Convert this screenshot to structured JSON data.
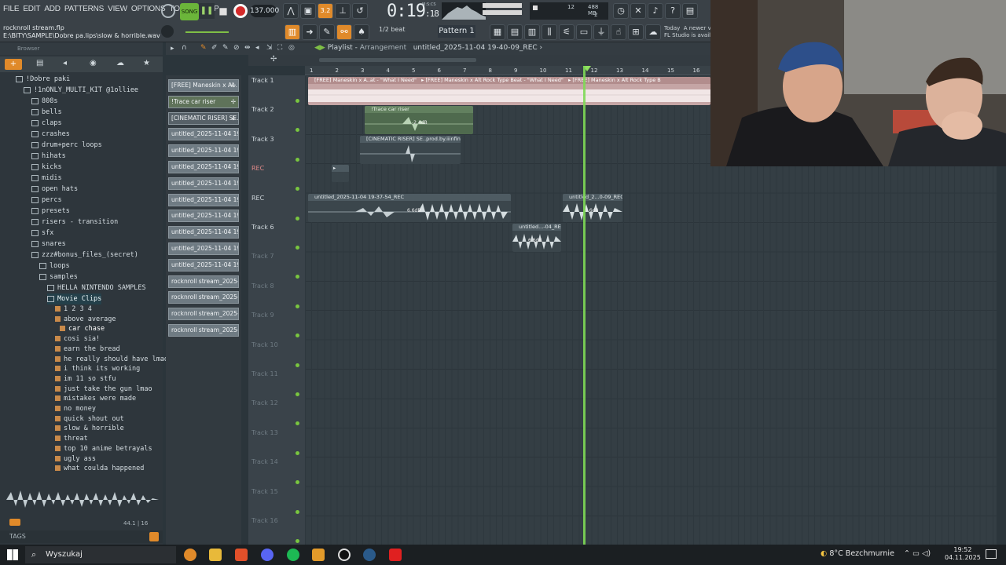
{
  "menu": [
    "FILE",
    "EDIT",
    "ADD",
    "PATTERNS",
    "VIEW",
    "OPTIONS",
    "TOOLS",
    "HELP"
  ],
  "transport": {
    "song": "SONG",
    "tempo": "137.000",
    "time_main": "0:19",
    "time_sub": ":18",
    "time_unit": "M:S:CS",
    "snap": "1/2 beat",
    "pattern": "Pattern 1"
  },
  "status": {
    "mem": "488 MB",
    "cpu_a": "12",
    "cpu_b": "2",
    "hint_date": "Today",
    "hint_text": "A newer ve",
    "hint_text2": "FL Studio is availal"
  },
  "project": {
    "file": "rocknroll stream.flp",
    "path": "E:\\BITY\\SAMPLE\\Dobre pa.lips\\slow & horrible.wav"
  },
  "browser": {
    "title": "Browser",
    "tree": [
      {
        "label": "!Dobre paki",
        "level": 1
      },
      {
        "label": "!1nONLY_MULTI_KIT @1olliee",
        "level": 2
      },
      {
        "label": "808s",
        "level": 3
      },
      {
        "label": "bells",
        "level": 3
      },
      {
        "label": "claps",
        "level": 3
      },
      {
        "label": "crashes",
        "level": 3
      },
      {
        "label": "drum+perc loops",
        "level": 3
      },
      {
        "label": "hihats",
        "level": 3
      },
      {
        "label": "kicks",
        "level": 3
      },
      {
        "label": "midis",
        "level": 3
      },
      {
        "label": "open hats",
        "level": 3
      },
      {
        "label": "percs",
        "level": 3
      },
      {
        "label": "presets",
        "level": 3
      },
      {
        "label": "risers - transition",
        "level": 3
      },
      {
        "label": "sfx",
        "level": 3
      },
      {
        "label": "snares",
        "level": 3
      },
      {
        "label": "zzz#bonus_files_(secret)",
        "level": 3
      },
      {
        "label": "loops",
        "level": 4
      },
      {
        "label": "samples",
        "level": 4
      },
      {
        "label": "HELLA NINTENDO SAMPLES",
        "level": 5
      },
      {
        "label": "Movie Clips",
        "level": 5
      }
    ],
    "files": [
      "1 2 3 4",
      "above average",
      "car chase",
      "cosi sia!",
      "earn the bread",
      "he really should have lmao",
      "i think its working",
      "im 11 so stfu",
      "just take the gun lmao",
      "mistakes were made",
      "no money",
      "quick shout out",
      "slow & horrible",
      "threat",
      "top 10 anime betrayals",
      "ugly ass",
      "what coulda happened"
    ],
    "preview_info": "44.1",
    "preview_bits": "16",
    "tags": "TAGS"
  },
  "patterns": [
    "[FREE] Maneskin x Al..",
    "!Trace car riser",
    "[CINEMATIC RISER] SE..",
    "untitled_2025-11-04 19-..",
    "untitled_2025-11-04 19-..",
    "untitled_2025-11-04 19-..",
    "untitled_2025-11-04 19-..",
    "untitled_2025-11-04 19-..",
    "untitled_2025-11-04 19-..",
    "untitled_2025-11-04 19-..",
    "untitled_2025-11-04 19-..",
    "untitled_2025-11-04 19-..",
    "rocknroll stream_2025-1..",
    "rocknroll stream_2025-1..",
    "rocknroll stream_2025-1..",
    "rocknroll stream_2025-1.."
  ],
  "playlist": {
    "title": "Playlist",
    "sub": "Arrangement",
    "clip_name": "untitled_2025-11-04 19-40-09_REC"
  },
  "ruler": [
    "1",
    "2",
    "3",
    "4",
    "5",
    "6",
    "7",
    "8",
    "9",
    "10",
    "11",
    "12",
    "13",
    "14",
    "15",
    "16"
  ],
  "tracks": [
    "Track 1",
    "Track 2",
    "Track 3",
    "REC",
    "REC",
    "Track 6",
    "Track 7",
    "Track 8",
    "Track 9",
    "Track 10",
    "Track 11",
    "Track 12",
    "Track 13",
    "Track 14",
    "Track 15",
    "Track 16"
  ],
  "clips": {
    "c1": "[FREE] Maneskin x A..at - \"What I Need\"",
    "c1b": "[FREE] Maneskin x Alt Rock Type Beat - \"What I Need\"",
    "c1c": "[FREE] Maneskin x Alt Rock Type B",
    "c2": "!Trace car riser",
    "c2v": "-2.4dB",
    "c3": "[CINEMATIC RISER] SE..prod.by.iiinfinite",
    "c5": "untitled_2025-11-04 19-37-54_REC",
    "c5v": "6.6dB",
    "c5b": "untitled_2...0-09_REC",
    "c5bv": "6.6dB",
    "c6": "untitled...-04_REC",
    "c6v": "6.6dB"
  },
  "taskbar": {
    "search": "Wyszukaj",
    "weather": "8°C",
    "weather_text": "Bezchmurnie",
    "time": "19:52",
    "date": "04.11.2025"
  }
}
